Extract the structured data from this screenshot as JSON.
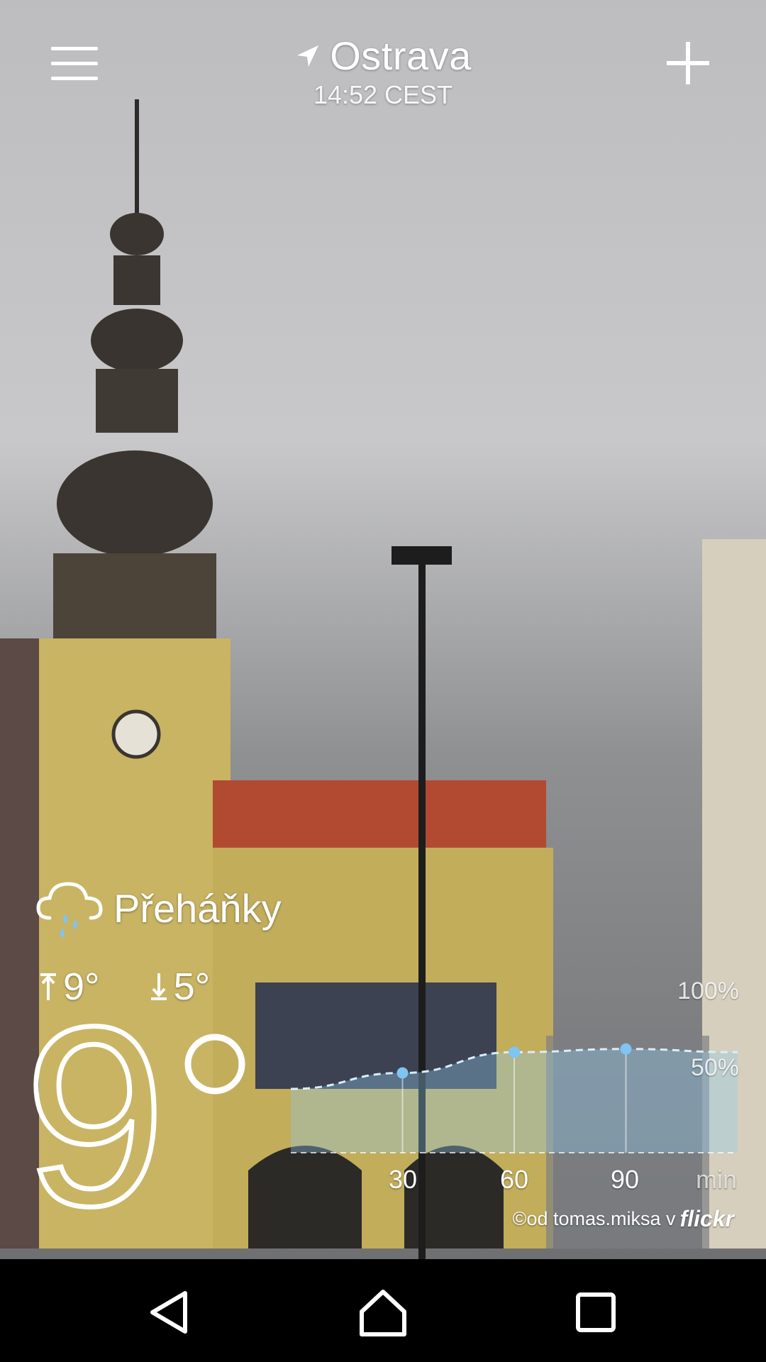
{
  "header": {
    "menu_icon": "hamburger-menu-icon",
    "location_icon": "location-arrow-icon",
    "city": "Ostrava",
    "time": "14:52 CEST",
    "add_icon": "plus-icon"
  },
  "weather": {
    "condition": "Přeháňky",
    "condition_icon": "cloud-rain-icon",
    "high": "9°",
    "low": "5°",
    "temperature": "9",
    "degree_icon": "degree-circle-icon"
  },
  "precipitation": {
    "axis_pct_top": "100%",
    "axis_pct_mid": "50%",
    "x_labels": [
      "30",
      "60",
      "90"
    ],
    "unit": "min",
    "chart_data": {
      "type": "area",
      "x": [
        0,
        30,
        60,
        90,
        120
      ],
      "y": [
        40,
        50,
        63,
        65,
        63
      ],
      "ylim": [
        0,
        100
      ],
      "y_ticks": [
        "100%",
        "50%"
      ],
      "x_labels": [
        "30",
        "60",
        "90"
      ],
      "xlabel": "min"
    }
  },
  "credit": {
    "text": "©od tomas.miksa v",
    "brand": "flickr"
  },
  "navbar": {
    "back_icon": "back-triangle-icon",
    "home_icon": "home-icon",
    "recents_icon": "recents-square-icon"
  },
  "colors": {
    "accent_dot": "#7fc4f2",
    "chart_fill": "#8fcaf0",
    "sky": "#a9aaac"
  }
}
